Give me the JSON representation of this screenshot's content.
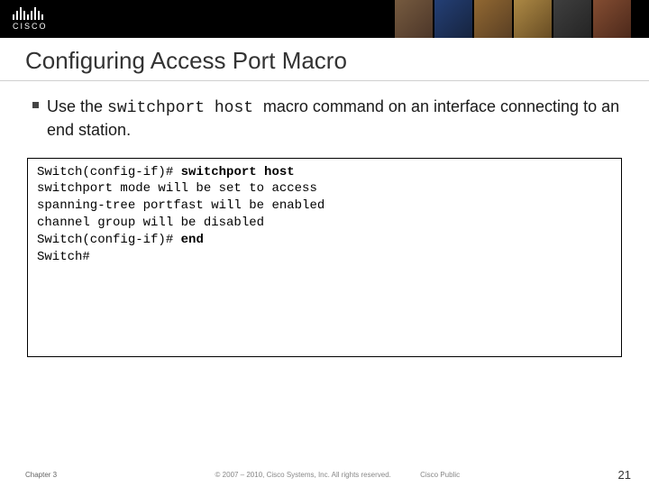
{
  "brand": {
    "name": "CISCO"
  },
  "title": "Configuring Access Port Macro",
  "bullet": {
    "pre": "Use the ",
    "cmd": "switchport host ",
    "post": "macro command on an interface connecting to an end station."
  },
  "code": {
    "l1_prompt": "Switch(config-if)# ",
    "l1_cmd": "switchport host",
    "l2": "switchport mode will be set to access",
    "l3": "spanning-tree portfast will be enabled",
    "l4": "channel group will be disabled",
    "l5_prompt": "Switch(config-if)# ",
    "l5_cmd": "end",
    "l6": "Switch#"
  },
  "footer": {
    "chapter": "Chapter 3",
    "copyright": "© 2007 – 2010, Cisco Systems, Inc. All rights reserved.",
    "classification": "Cisco Public",
    "page": "21"
  }
}
